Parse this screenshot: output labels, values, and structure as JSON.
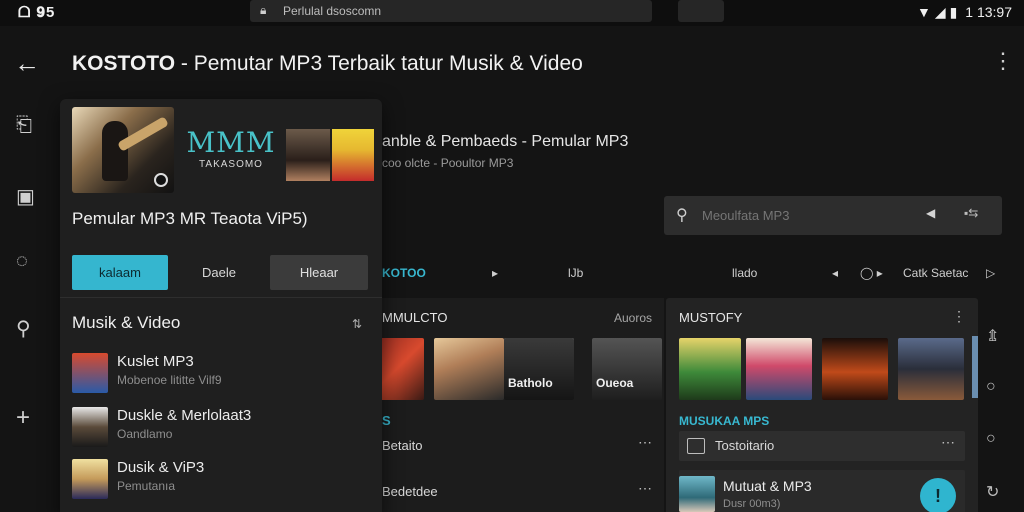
{
  "status_bar": {
    "left_text": "ᗝ 𝟗5",
    "url_text": "Perlulal dsoscomn",
    "right_icons": [
      "wifi-icon",
      "signal-icon",
      "battery-icon"
    ],
    "time": "1 13:97"
  },
  "header": {
    "brand": "KOSTOTO",
    "title_rest": " - Pemutar MP3 Terbaik tatur Musik & Video"
  },
  "left_rail": [
    "back-arrow-icon",
    "file-icon",
    "folder-icon",
    "chat-search-icon",
    "search-icon",
    "plus-icon"
  ],
  "popup": {
    "logo_big": "MMM",
    "logo_small": "TAKASOMO",
    "heading": "Pemular MP3 MR Teaota ViP5)",
    "buttons": [
      "kalaam",
      "Daele",
      "Hleaar"
    ],
    "section_title": "Musik & Video",
    "items": [
      {
        "name": "Kuslet MP3",
        "sub": "Mobenoe lititte Vilf9"
      },
      {
        "name": "Duskle & Merlolaat3",
        "sub": "Oandlamo"
      },
      {
        "name": "Dusik & ViP3",
        "sub": "Pemutanıa"
      }
    ]
  },
  "main": {
    "heading": "anble & Pembaeds - Pemular MP3",
    "subheading": "coo olcte - Pooultor MP3",
    "search_placeholder": "Meoulfata MP3",
    "tabs": [
      "KOTOO",
      "▸",
      "lJb",
      "llado",
      "◂",
      "◯ ▸",
      "Catk Saetac",
      "▷"
    ],
    "left_panel": {
      "title": "MMULCTO",
      "link": "Auoros",
      "thumbs": [
        "",
        "",
        "",
        "Batholo",
        "Oueoa"
      ],
      "section": "S",
      "rows": [
        "Betaito",
        "Bedetdee"
      ]
    },
    "right_panel": {
      "title": "MUSTOFY",
      "section": "MUSUKAA MPS",
      "row1": "Tostoitario",
      "row2_title": "Mutuat & MP3",
      "row2_sub": "Dusr 00m3)"
    },
    "fab_label": "!"
  },
  "colors": {
    "accent": "#35b6cf",
    "background": "#141414",
    "panel": "#1f1f1f"
  }
}
